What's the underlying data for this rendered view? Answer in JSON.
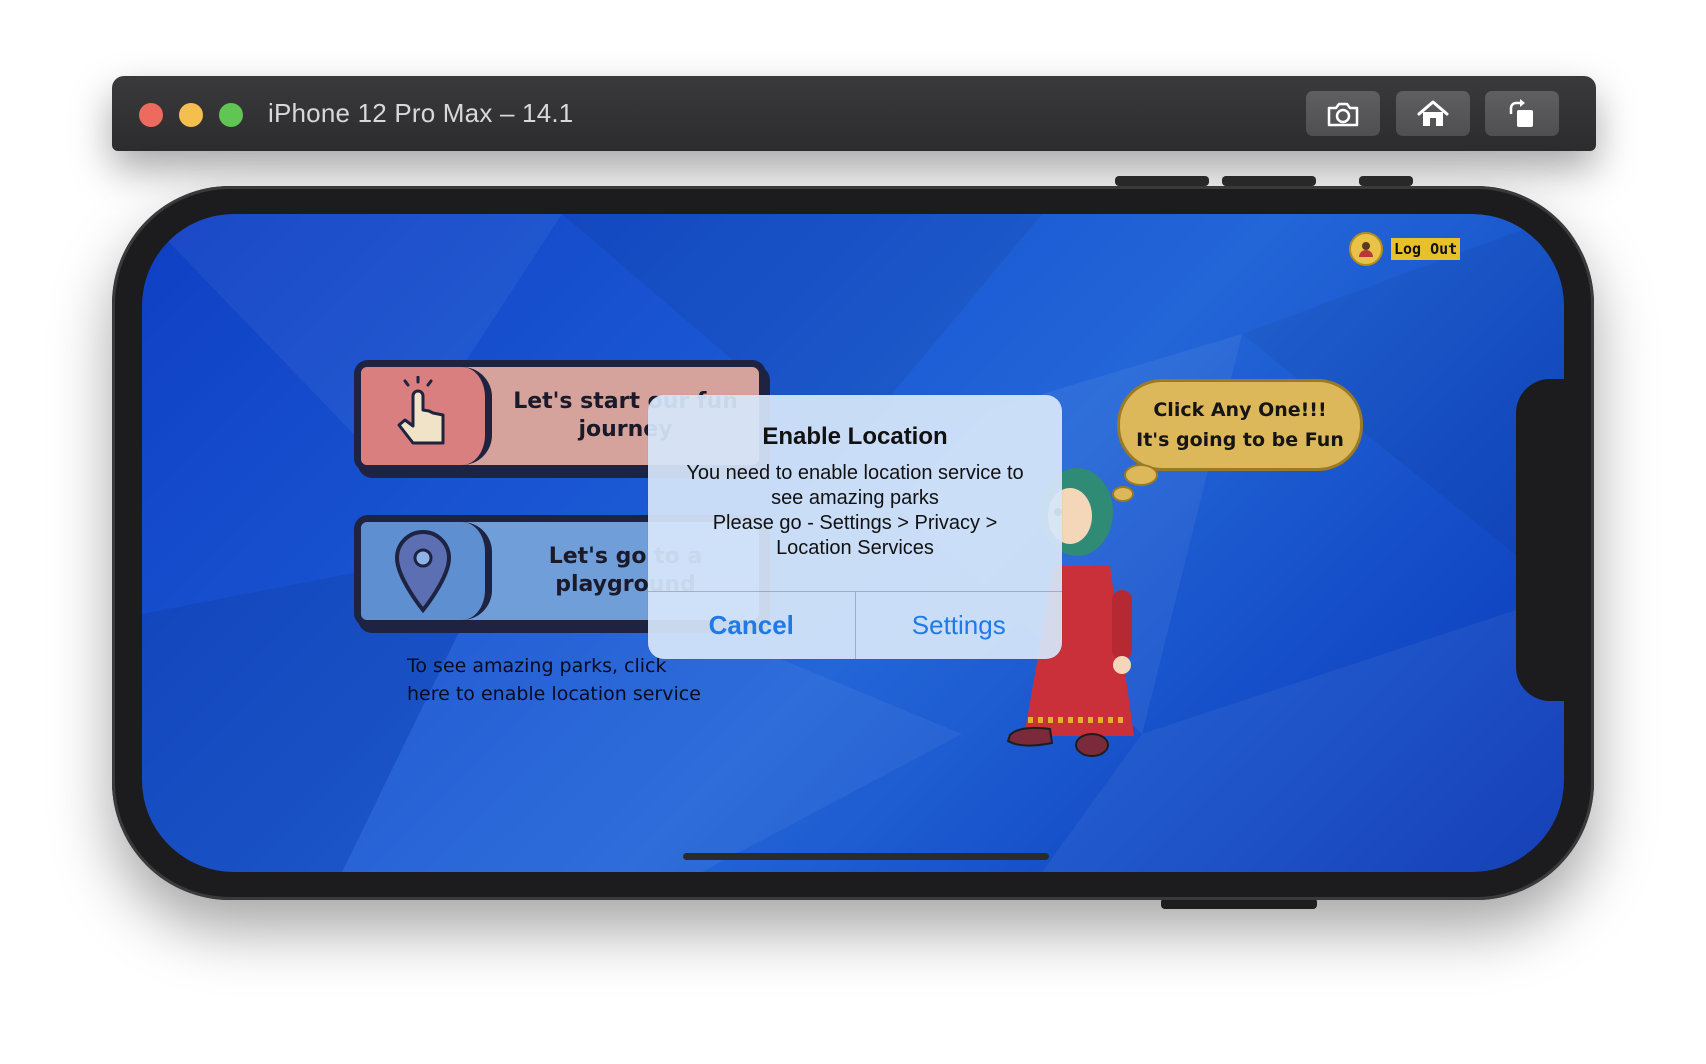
{
  "window": {
    "title": "iPhone 12 Pro Max – 14.1",
    "toolbar": {
      "screenshot_icon": "camera-icon",
      "home_icon": "home-icon",
      "rotate_icon": "rotate-icon"
    }
  },
  "app": {
    "logout_label": "Log Out",
    "cards": [
      {
        "label_line1": "Let's start our fun",
        "label_line2": "journey",
        "icon": "pointing-hand-icon"
      },
      {
        "label_line1": "Let's go to a",
        "label_line2": "playground",
        "icon": "map-pin-icon"
      }
    ],
    "hint": {
      "line1": "To see amazing parks, click",
      "line2": "here to enable location service"
    },
    "bubble": {
      "line1": "Click Any One!!!",
      "line2": "It's going to be Fun"
    }
  },
  "alert": {
    "title": "Enable Location",
    "message_lines": [
      "You need to enable location service to",
      "see amazing parks",
      "Please go - Settings > Privacy >",
      "Location Services"
    ],
    "cancel_label": "Cancel",
    "settings_label": "Settings"
  },
  "colors": {
    "accent": "#1f7ae8",
    "background": "#1a57d3",
    "logout_bg": "#e8c02a"
  }
}
